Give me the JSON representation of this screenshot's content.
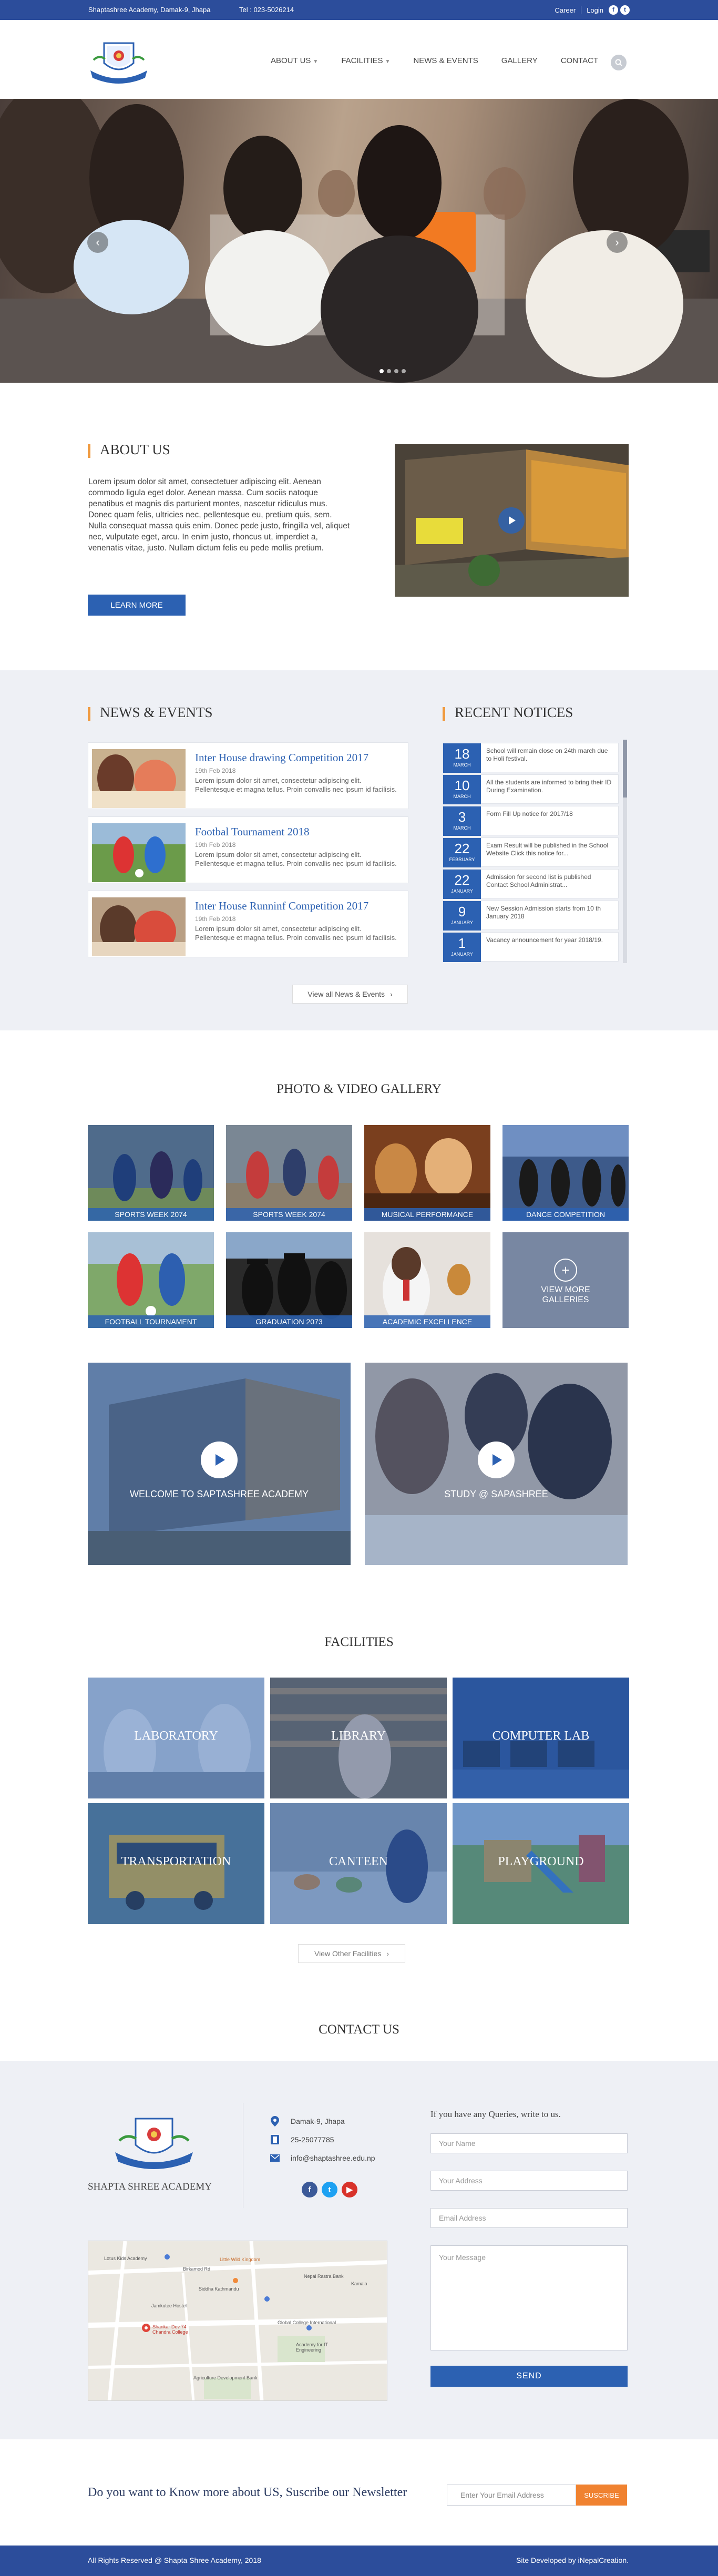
{
  "topbar": {
    "address": "Shaptashree Academy, Damak-9, Jhapa",
    "phone": "Tel : 023-5026214",
    "career": "Career",
    "login": "Login"
  },
  "nav": {
    "about": "ABOUT US",
    "facilities": "FACILITIES",
    "news": "NEWS & EVENTS",
    "gallery": "GALLERY",
    "contact": "CONTACT"
  },
  "about": {
    "title": "ABOUT US",
    "text": "Lorem ipsum dolor sit amet, consectetuer adipiscing elit. Aenean commodo ligula eget dolor. Aenean massa. Cum sociis natoque penatibus et magnis dis parturient montes, nascetur ridiculus mus. Donec quam felis, ultricies nec, pellentesque eu, pretium quis, sem. Nulla consequat massa quis enim. Donec pede justo, fringilla vel, aliquet nec, vulputate eget, arcu. In enim justo, rhoncus ut, imperdiet a, venenatis vitae, justo. Nullam dictum felis eu pede mollis pretium.",
    "button": "LEARN MORE"
  },
  "news": {
    "title": "NEWS & EVENTS",
    "items": [
      {
        "title": "Inter House drawing Competition 2017",
        "date": "19th Feb 2018",
        "desc": "Lorem ipsum dolor sit amet, consectetur adipiscing elit. Pellentesque et magna tellus. Proin convallis nec ipsum id facilisis."
      },
      {
        "title": "Footbal Tournament 2018",
        "date": "19th Feb 2018",
        "desc": "Lorem ipsum dolor sit amet, consectetur adipiscing elit. Pellentesque et magna tellus. Proin convallis nec ipsum id facilisis."
      },
      {
        "title": "Inter House Runninf Competition 2017",
        "date": "19th Feb 2018",
        "desc": "Lorem ipsum dolor sit amet, consectetur adipiscing elit. Pellentesque et magna tellus. Proin convallis nec ipsum id facilisis."
      }
    ],
    "view_all": "View all News & Events"
  },
  "notices": {
    "title": "RECENT NOTICES",
    "items": [
      {
        "day": "18",
        "month": "MARCH",
        "text": "School will remain close on 24th march due to Holi festival."
      },
      {
        "day": "10",
        "month": "MARCH",
        "text": "All the students are informed to bring their ID During Examination."
      },
      {
        "day": "3",
        "month": "MARCH",
        "text": "Form Fill Up notice for 2017/18"
      },
      {
        "day": "22",
        "month": "FEBRUARY",
        "text": "Exam Result will be published in the School Website Click this notice for..."
      },
      {
        "day": "22",
        "month": "JANUARY",
        "text": "Admission for second list is published Contact School Administrat..."
      },
      {
        "day": "9",
        "month": "JANUARY",
        "text": "New Session Admission starts from 10 th January 2018"
      },
      {
        "day": "1",
        "month": "JANUARY",
        "text": "Vacancy announcement for year 2018/19."
      }
    ]
  },
  "gallery": {
    "title": "PHOTO & VIDEO GALLERY",
    "tiles": [
      "SPORTS WEEK 2074",
      "SPORTS WEEK 2074",
      "MUSICAL PERFORMANCE",
      "DANCE COMPETITION",
      "FOOTBALL TOURNAMENT",
      "GRADUATION 2073",
      "ACADEMIC EXCELLENCE"
    ],
    "view_more": "VIEW MORE GALLERIES",
    "videos": [
      "WELCOME TO SAPTASHREE ACADEMY",
      "STUDY @ SAPASHREE"
    ]
  },
  "facilities": {
    "title": "FACILITIES",
    "tiles": [
      "LABORATORY",
      "LIBRARY",
      "COMPUTER LAB",
      "TRANSPORTATION",
      "CANTEEN",
      "PLAYGROUND"
    ],
    "view_other": "View Other Facilities"
  },
  "contact": {
    "title": "CONTACT US",
    "school_name": "SHAPTA SHREE ACADEMY",
    "address": "Damak-9, Jhapa",
    "phone": "25-25077785",
    "email": "info@shaptashree.edu.np",
    "query_label": "If you have any Queries, write to us.",
    "placeholders": {
      "name": "Your Name",
      "address": "Your Address",
      "email": "Email Address",
      "message": "Your Message"
    },
    "send": "SEND"
  },
  "map": {
    "labels": [
      "Lotus Kids Academy",
      "Little Wild Kingdom",
      "Birkamod Rd",
      "Siddha Kathmandu",
      "Jamkutee Hostel",
      "Global College International",
      "Agriculture Development Bank",
      "Shankar Dev 74 Chandra College",
      "Academy for IT Engineering",
      "Nepal Rastra Bank",
      "Kamala"
    ]
  },
  "newsletter": {
    "text": "Do you want to Know more about US, Suscribe our Newsletter",
    "placeholder": "Enter Your Email Address",
    "button": "SUSCRIBE"
  },
  "footer": {
    "copyright": "All Rights Reserved @ Shapta Shree Academy, 2018",
    "credit": "Site Developed by  iNepalCreation."
  },
  "colors": {
    "primary": "#2c4d9b",
    "accent": "#2c61b2",
    "orange": "#f09a3e",
    "footer": "#2c4d9b"
  }
}
